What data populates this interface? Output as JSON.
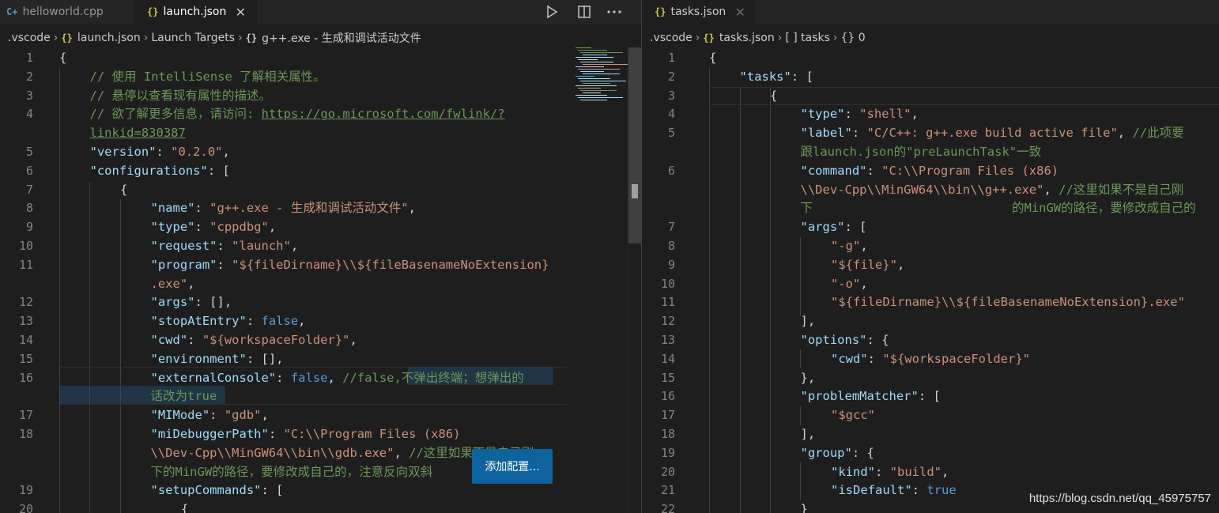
{
  "colors": {
    "background": "#1e1e1e",
    "tab_bar": "#252526",
    "key": "#9cdcfe",
    "string": "#ce9178",
    "keyword": "#569cd6",
    "comment": "#6a9955",
    "line_number": "#858585",
    "tooltip_button": "#0e639c"
  },
  "left": {
    "tabs": [
      {
        "icon": "C+",
        "label": "helloworld.cpp",
        "active": false
      },
      {
        "icon": "{}",
        "label": "launch.json",
        "active": true,
        "close": "✕"
      }
    ],
    "breadcrumb": [
      ".vscode",
      "launch.json",
      "Launch Targets",
      "g++.exe - 生成和调试活动文件"
    ],
    "line_numbers": [
      "1",
      "2",
      "3",
      "4",
      "5",
      "6",
      "7",
      "8",
      "9",
      "10",
      "11",
      "12",
      "13",
      "14",
      "15",
      "16",
      "17",
      "18",
      "19",
      "20"
    ],
    "tooltip": "添加配置..."
  },
  "right": {
    "tabs": [
      {
        "icon": "{}",
        "label": "tasks.json",
        "active": true,
        "close": "✕"
      }
    ],
    "breadcrumb": [
      ".vscode",
      "tasks.json",
      "[ ] tasks",
      "{} 0"
    ],
    "line_numbers": [
      "1",
      "2",
      "3",
      "4",
      "5",
      "6",
      "7",
      "8",
      "9",
      "10",
      "11",
      "12",
      "13",
      "14",
      "15",
      "16",
      "17",
      "18",
      "19",
      "20",
      "21",
      "22"
    ]
  },
  "watermark": "https://blog.csdn.net/qq_45975757"
}
